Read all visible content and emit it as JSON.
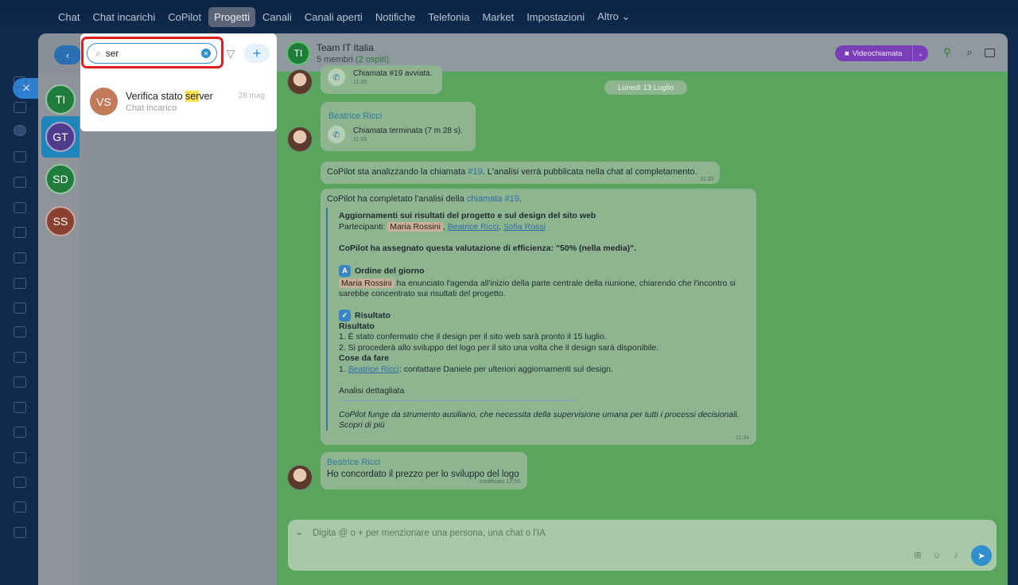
{
  "topnav": {
    "items": [
      {
        "label": "Chat"
      },
      {
        "label": "Chat incarichi"
      },
      {
        "label": "CoPilot"
      },
      {
        "label": "Progetti"
      },
      {
        "label": "Canali"
      },
      {
        "label": "Canali aperti"
      },
      {
        "label": "Notifiche"
      },
      {
        "label": "Telefonia"
      },
      {
        "label": "Market"
      },
      {
        "label": "Impostazioni"
      },
      {
        "label": "Altro ⌄"
      }
    ],
    "active": "Progetti"
  },
  "sidebar": {
    "close_label": "✕",
    "back_label": "‹",
    "projects": [
      {
        "initials": "TI",
        "color": "#1f7c3a"
      },
      {
        "initials": "GT",
        "color": "#4f3c8c"
      },
      {
        "initials": "SD",
        "color": "#1f7c3a"
      },
      {
        "initials": "SS",
        "color": "#8a4030"
      }
    ]
  },
  "search": {
    "value": "ser",
    "clear_icon": "clear-icon",
    "filter_icon": "filter-icon",
    "add_label": "+",
    "result": {
      "initials": "VS",
      "title_before": "Verifica stato ",
      "title_match": "ser",
      "title_after": "ver",
      "subtitle": "Chat incarico",
      "date": "28 mag"
    }
  },
  "chat": {
    "title": "Team IT Italia",
    "members": "5 membri",
    "guests": "(2 ospiti)",
    "avatar_initials": "TI",
    "video_label": "Videochiamata",
    "date_separator": "Lunedì 13 Luglio",
    "msg1_text": "Chiamata #19 avviata.",
    "msg1_time": "11:26",
    "msg2_sender": "Beatrice Ricci",
    "msg2_text": "Chiamata terminata (7 m 28 s).",
    "msg2_time": "11:33",
    "msg3_before": "CoPilot sta analizzando la chiamata ",
    "msg3_link": "#19",
    "msg3_after": ". L'analisi verrà pubblicata nella chat al completamento.",
    "msg3_time": "11:33",
    "msg4": {
      "intro_before": "CoPilot ha completato l'analisi della ",
      "intro_link": "chiamata #19",
      "intro_after": ".",
      "heading": "Aggiornamenti sui risultati del progetto e sul design del sito web",
      "participants_label": "Partecipanti:",
      "participant1": "Maria Rossini",
      "participant2": "Beatrice Ricci",
      "participant3": "Sofia Rossi",
      "efficiency": "CoPilot ha assegnato questa valutazione di efficienza: \"50% (nella media)\".",
      "agenda_title": "Ordine del giorno",
      "agenda_mention": "Maria Rossini",
      "agenda_text": " ha enunciato l'agenda all'inizio della parte centrale della riunione, chiarendo che l'incontro si sarebbe concentrato sui risultati del progetto.",
      "result_title": "Risultato",
      "result_sub": "Risultato",
      "result_1": "1. È stato confermato che il design per il sito web sarà pronto il 15 luglio.",
      "result_2": "2. Si procederà allo sviluppo del logo per il sito una volta che il design sarà disponibile.",
      "todo_title": "Cose da fare",
      "todo_prefix": "1. ",
      "todo_mention": "Beatrice Ricci",
      "todo_text": ": contattare Daniele per ulteriori aggiornamenti sul design.",
      "details_link": "Analisi dettagliata",
      "disclaimer": "CoPilot funge da strumento ausiliario, che necessita della supervisione umana per tutti i processi decisionali.",
      "learn_more": "Scopri di più",
      "time": "11:34"
    },
    "msg5_sender": "Beatrice Ricci",
    "msg5_text": "Ho concordato il prezzo per lo sviluppo del logo",
    "msg5_time": "modificato 12:55",
    "input_placeholder": "Digita @ o + per menzionare una persona, una chat o l'IA"
  }
}
